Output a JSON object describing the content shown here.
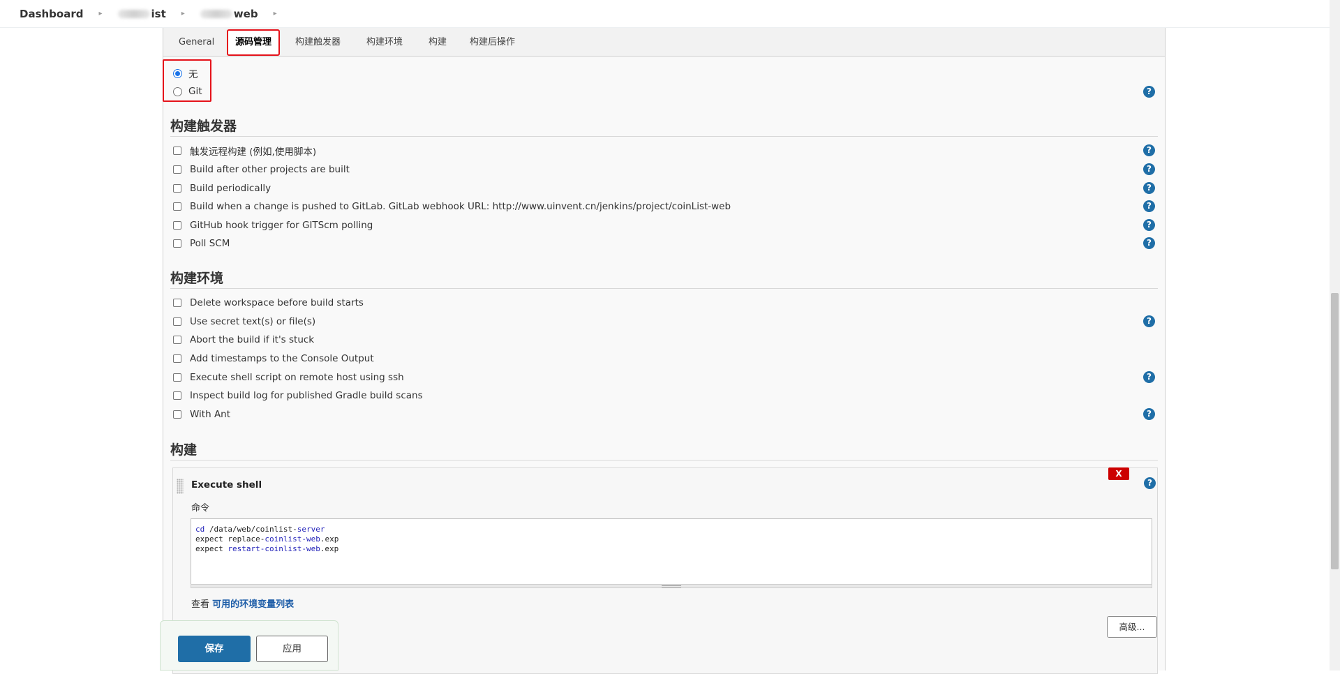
{
  "breadcrumb": {
    "items": [
      "Dashboard",
      "ist",
      "web"
    ]
  },
  "tabs": [
    "General",
    "源码管理",
    "构建触发器",
    "构建环境",
    "构建",
    "构建后操作"
  ],
  "scm": {
    "options": [
      "无",
      "Git"
    ],
    "selected": "无"
  },
  "triggers": {
    "title": "构建触发器",
    "items": [
      "触发远程构建 (例如,使用脚本)",
      "Build after other projects are built",
      "Build periodically",
      "Build when a change is pushed to GitLab. GitLab webhook URL: http://www.uinvent.cn/jenkins/project/coinList-web",
      "GitHub hook trigger for GITScm polling",
      "Poll SCM"
    ]
  },
  "environment": {
    "title": "构建环境",
    "items": [
      "Delete workspace before build starts",
      "Use secret text(s) or file(s)",
      "Abort the build if it's stuck",
      "Add timestamps to the Console Output",
      "Execute shell script on remote host using ssh",
      "Inspect build log for published Gradle build scans",
      "With Ant"
    ]
  },
  "build": {
    "title": "构建",
    "step_title": "Execute shell",
    "delete_label": "X",
    "command_label": "命令",
    "command_lines": [
      [
        "cd",
        " /data/web/coinlist-",
        "server",
        ""
      ],
      [
        "",
        "expect replace-",
        "coinlist-web",
        ".exp"
      ],
      [
        "",
        "expect ",
        "restart-coinlist-web",
        ".exp"
      ]
    ],
    "env_prefix": "查看 ",
    "env_link": "可用的环境变量列表",
    "advanced_label": "高级..."
  },
  "footer": {
    "save_label": "保存",
    "apply_label": "应用"
  },
  "help_glyph": "?",
  "colors": {
    "accent": "#1f6ea7",
    "highlight": "#e5121a",
    "danger": "#cc0000"
  }
}
